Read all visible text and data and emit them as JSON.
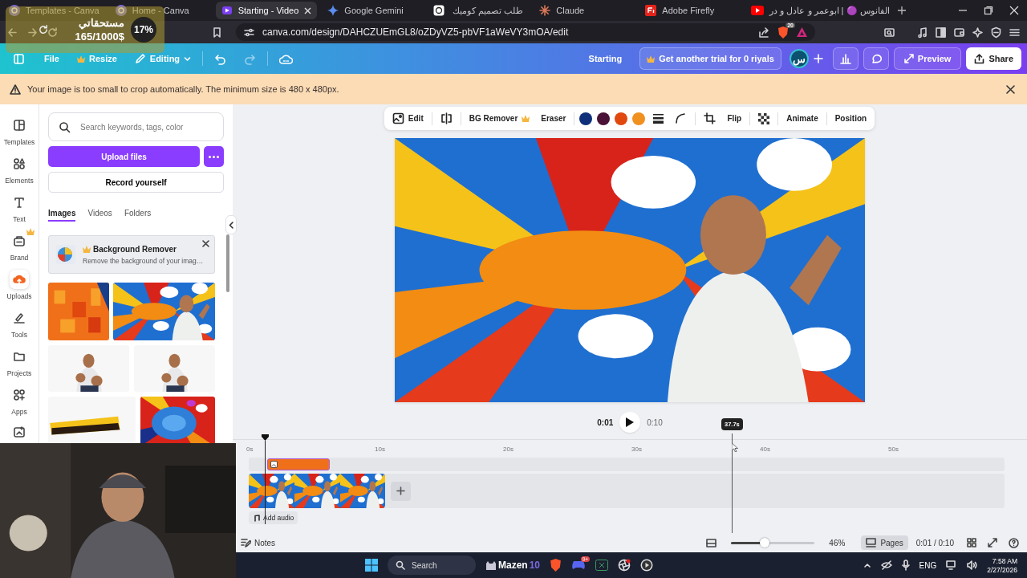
{
  "browser": {
    "tabs": [
      {
        "title": "Templates - Canva",
        "selected": false
      },
      {
        "title": "Home - Canva",
        "selected": false
      },
      {
        "title": "Starting - Video",
        "selected": true
      },
      {
        "title": "Google Gemini",
        "selected": false
      },
      {
        "title": "طلب تصميم كوميك",
        "selected": false
      },
      {
        "title": "Claude",
        "selected": false
      },
      {
        "title": "Adobe Firefly",
        "selected": false
      },
      {
        "title": "الفانوس 🟣 | ابوعمر و عادل و در",
        "selected": false
      }
    ],
    "url": "canva.com/design/DAHCZUEmGL8/oZDyVZ5-pbVF1aWeVY3mOA/edit",
    "brave_badge": "20"
  },
  "stream_overlay": {
    "label": "مستحقاتي",
    "amount": "165/1000$",
    "percent": "17%"
  },
  "topbar": {
    "file": "File",
    "resize": "Resize",
    "editing": "Editing",
    "design_title": "Starting",
    "trial": "Get another trial for 0 riyals",
    "avatar": "س",
    "preview": "Preview",
    "share": "Share"
  },
  "notice": "Your image is too small to crop automatically. The minimum size is 480 x 480px.",
  "nav": [
    {
      "label": "Templates",
      "selected": false
    },
    {
      "label": "Elements",
      "selected": false
    },
    {
      "label": "Text",
      "selected": false
    },
    {
      "label": "Brand",
      "selected": false
    },
    {
      "label": "Uploads",
      "selected": true
    },
    {
      "label": "Tools",
      "selected": false
    },
    {
      "label": "Projects",
      "selected": false
    },
    {
      "label": "Apps",
      "selected": false
    }
  ],
  "panel": {
    "search_placeholder": "Search keywords, tags, color",
    "upload": "Upload files",
    "record": "Record yourself",
    "tabs": [
      {
        "label": "Images",
        "selected": true
      },
      {
        "label": "Videos",
        "selected": false
      },
      {
        "label": "Folders",
        "selected": false
      }
    ],
    "promo": {
      "title": "Background Remover",
      "text": "Remove the background of your imag…"
    }
  },
  "toolbar": {
    "edit": "Edit",
    "bg_remover": "BG Remover",
    "eraser": "Eraser",
    "colors": [
      {
        "color": "#0f2f7a"
      },
      {
        "color": "#4a1236"
      },
      {
        "color": "#e0480f"
      },
      {
        "color": "#f0901f"
      }
    ],
    "flip": "Flip",
    "animate": "Animate",
    "position": "Position"
  },
  "playback": {
    "current": "0:01",
    "total": "0:10",
    "playing": false
  },
  "timeline": {
    "ticks": [
      "0s",
      "10s",
      "20s",
      "30s",
      "40s",
      "50s"
    ],
    "hover_time": "37.7s",
    "add_audio": "Add audio"
  },
  "footer": {
    "notes": "Notes",
    "zoom": {
      "level": 0.4,
      "reading": "46%"
    },
    "pages": "Pages",
    "time": "0:01 / 0:10"
  },
  "taskbar": {
    "search": "Search",
    "widget": "Mazen",
    "widget_count": "10",
    "discord_badge": "9+",
    "language": "ENG",
    "time": "7:58 AM",
    "date": "2/27/2026"
  }
}
